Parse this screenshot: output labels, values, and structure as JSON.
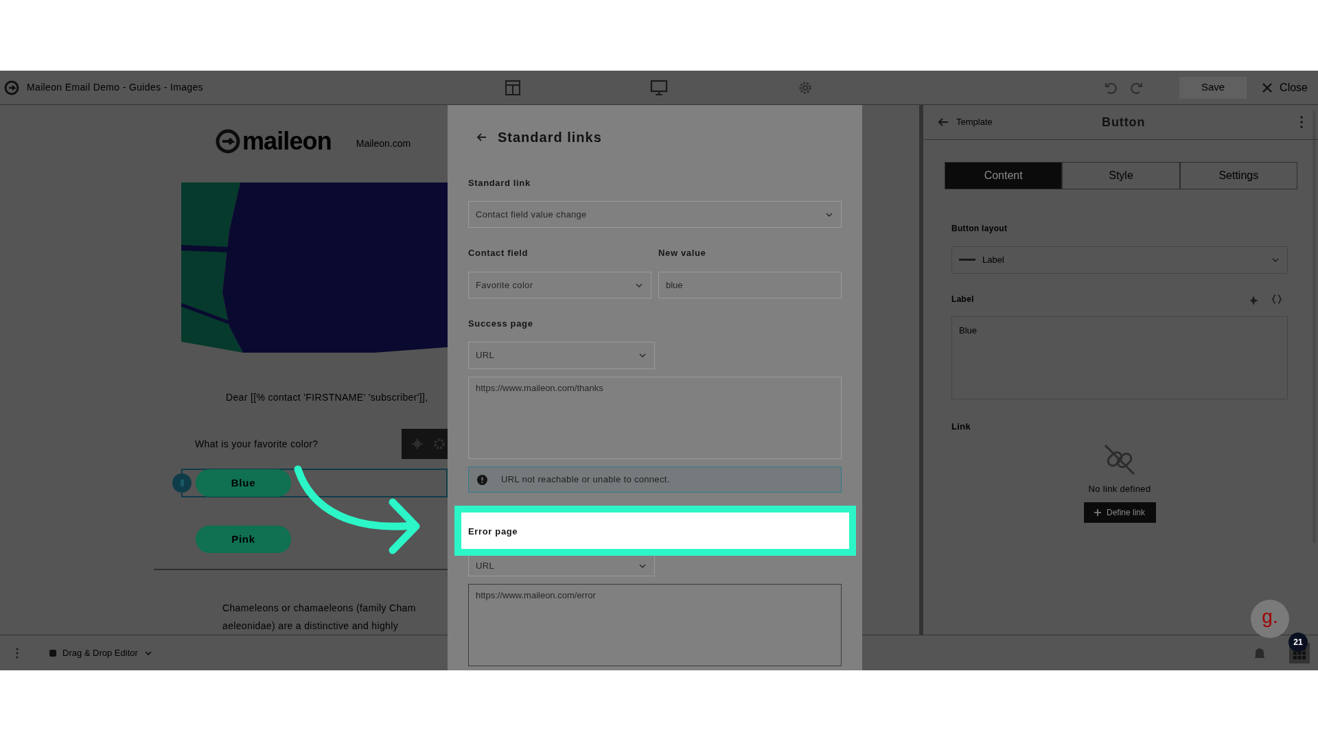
{
  "app_bar": {
    "title": "Maileon Email Demo - Guides - Images",
    "save": "Save",
    "close": "Close"
  },
  "email": {
    "logo_text": "maileon",
    "brand_link": "Maileon.com",
    "greeting": "Dear [[% contact 'FIRSTNAME' 'subscriber']],",
    "question": "What is your favorite color?",
    "answers": [
      {
        "label": "Blue",
        "selected": true
      },
      {
        "label": "Pink",
        "selected": false
      }
    ],
    "paragraph_lines": [
      "Chameleons or chamaeleons (family Cham",
      "aeleonidae) are a distinctive and highly"
    ]
  },
  "editor_bar": {
    "mode": "Drag & Drop Editor"
  },
  "panel": {
    "back": "Template",
    "title": "Button",
    "tabs": [
      {
        "label": "Content",
        "selected": true
      },
      {
        "label": "Style",
        "selected": false
      },
      {
        "label": "Settings",
        "selected": false
      }
    ],
    "layout_label": "Button layout",
    "layout_value": "Label",
    "label_label": "Label",
    "label_value": "Blue",
    "link_label": "Link",
    "empty_text": "No link defined",
    "define_button": "Define link"
  },
  "dialog": {
    "title": "Standard links",
    "standard_link": {
      "label": "Standard link",
      "value": "Contact field value change"
    },
    "contact_field": {
      "label": "Contact field",
      "value": "Favorite color"
    },
    "new_value": {
      "label": "New value",
      "value": "blue"
    },
    "success_page": {
      "label": "Success page",
      "type": "URL",
      "url": "https://www.maileon.com/thanks"
    },
    "alert": "URL not reachable or unable to connect.",
    "error_page": {
      "label": "Error page",
      "type": "URL",
      "url": "https://www.maileon.com/error",
      "highlighted": true
    }
  },
  "assistant": {
    "logo": "g.",
    "badge": "21"
  }
}
